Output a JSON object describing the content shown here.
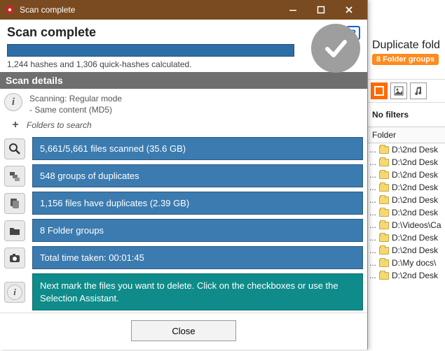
{
  "window": {
    "title": "Scan complete",
    "heading": "Scan complete",
    "hash_summary": "1,244 hashes and 1,306 quick-hashes calculated.",
    "section_label": "Scan details"
  },
  "details": {
    "line1": "Scanning: Regular mode",
    "line2": "- Same content (MD5)",
    "folders_label": "Folders to search"
  },
  "stats": {
    "scanned": "5,661/5,661 files scanned (35.6 GB)",
    "groups": "548 groups of duplicates",
    "dupes": "1,156 files have duplicates (2.39 GB)",
    "folder_groups": "8 Folder groups",
    "time": "Total time taken: 00:01:45",
    "hint": "Next mark the files you want to delete. Click on the checkboxes or use the Selection Assistant."
  },
  "buttons": {
    "close": "Close"
  },
  "background": {
    "title": "Duplicate fold",
    "badge": "8 Folder groups",
    "no_filters": "No filters",
    "col_folder": "Folder",
    "rows": [
      "D:\\2nd Desk",
      "D:\\2nd Desk",
      "D:\\2nd Desk",
      "D:\\2nd Desk",
      "D:\\2nd Desk",
      "D:\\2nd Desk",
      "D:\\Videos\\Ca",
      "D:\\2nd Desk",
      "D:\\2nd Desk",
      "D:\\My docs\\",
      "D:\\2nd Desk"
    ]
  }
}
